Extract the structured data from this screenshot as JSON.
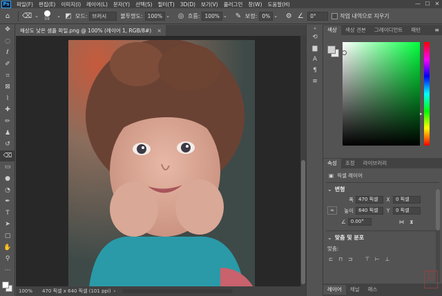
{
  "menubar": {
    "logo": "Ps",
    "items": [
      "파일(F)",
      "편집(E)",
      "이미지(I)",
      "레이어(L)",
      "문자(Y)",
      "선택(S)",
      "필터(T)",
      "3D(D)",
      "보기(V)",
      "플러그인",
      "창(W)",
      "도움말(H)"
    ],
    "window_controls": [
      "—",
      "☐",
      "✕"
    ]
  },
  "options": {
    "brush_size": "59",
    "mode_label": "모드:",
    "mode_value": "브러시",
    "opacity_label": "불투명도:",
    "opacity_value": "100%",
    "flow_label": "흐름:",
    "flow_value": "100%",
    "smoothing_label": "보정:",
    "smoothing_value": "0%",
    "angle_value": "0°",
    "history_label": "작업 내역으로 지우기"
  },
  "toolbar": {
    "tools": [
      "move",
      "marquee",
      "lasso",
      "quick-select",
      "crop",
      "frame",
      "eyedropper",
      "healing",
      "brush",
      "clone-stamp",
      "history-brush",
      "eraser",
      "gradient",
      "blur",
      "dodge",
      "pen",
      "type",
      "path-select",
      "rectangle",
      "hand",
      "zoom"
    ]
  },
  "document": {
    "tab_title": "해상도 낮은 샘플 파일.png @ 100% (레이어 1, RGB/8#)",
    "close": "×",
    "status_zoom": "100%",
    "status_info": "470 픽셀 x 640 픽셀 (101 ppi)",
    "status_arrow": "›"
  },
  "color_panel": {
    "tabs": [
      "색상",
      "색상 견본",
      "그레이디언트",
      "패턴"
    ],
    "colors": {
      "foreground": "#d2d2d2",
      "background": "#e8e8e8",
      "hue": "#00ff3c"
    }
  },
  "properties": {
    "tabs": [
      "속성",
      "조정",
      "라이브러리"
    ],
    "layer_type": "픽셀 레이어",
    "transform_title": "변형",
    "w_label": "폭",
    "w_value": "470 픽셀",
    "x_label": "X",
    "x_value": "0 픽셀",
    "h_label": "높이",
    "h_value": "640 픽셀",
    "y_label": "Y",
    "y_value": "0 픽셀",
    "angle_value": "0.00°",
    "align_title": "맞춤 및 분포",
    "align_label": "맞춤:"
  },
  "bottom_tabs": [
    "레이어",
    "채널",
    "패스"
  ],
  "watermark": "검사 확인"
}
